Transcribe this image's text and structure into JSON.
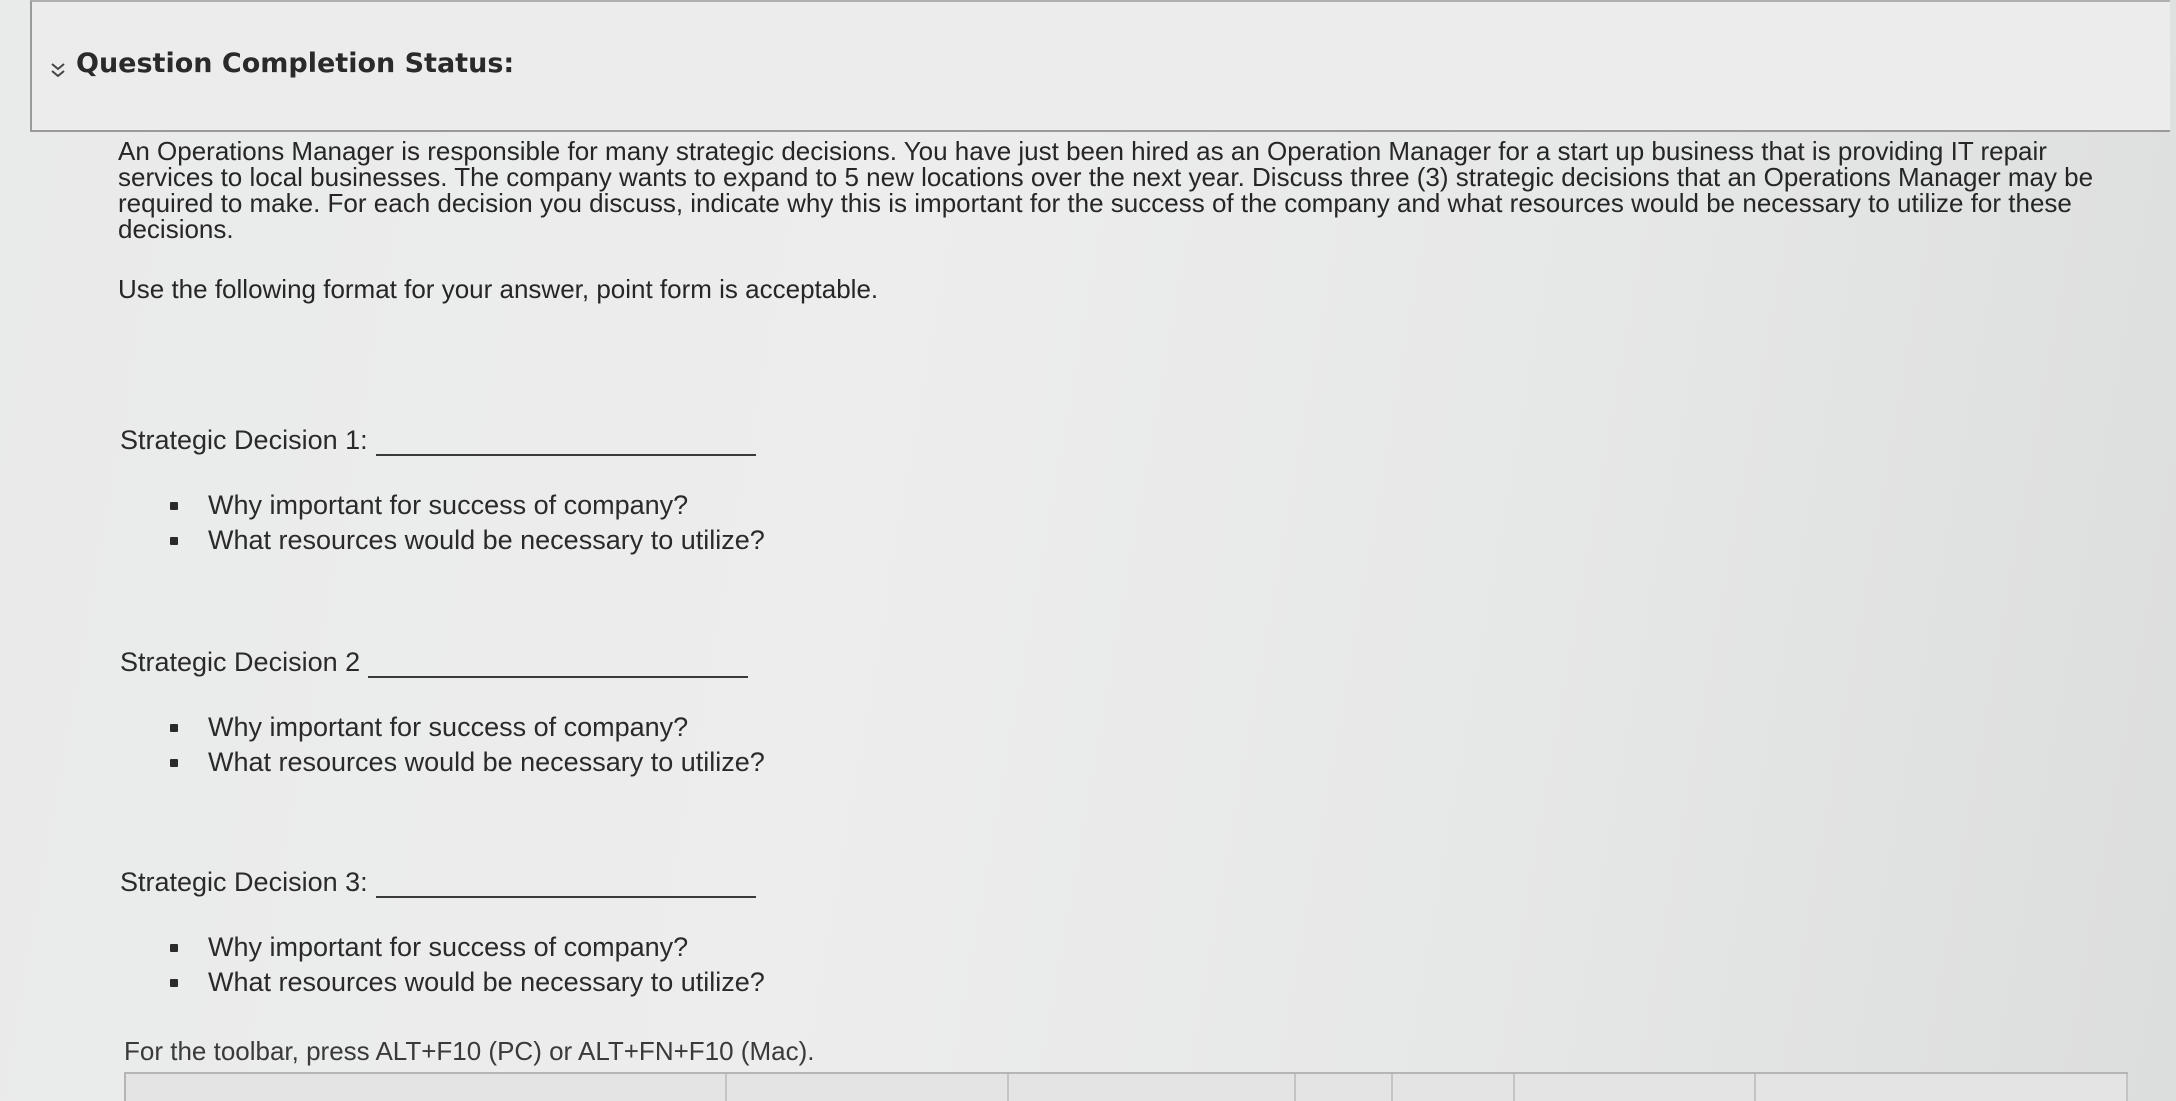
{
  "status": {
    "header": "Question Completion Status:"
  },
  "question": {
    "paragraph": "An Operations Manager is responsible for many strategic decisions. You have just been hired as an Operation Manager for a start up business that is providing IT repair services to local businesses. The company wants to expand to 5 new locations over the next year. Discuss three (3) strategic decisions that an Operations Manager may be required to make. For each decision you discuss, indicate why this is important for the success of the company and what resources would be necessary to utilize for these decisions.",
    "instruction": "Use the following format for your answer, point form is acceptable."
  },
  "decisions": [
    {
      "title": "Strategic Decision 1:",
      "bullets": [
        "Why important for success of company?",
        "What resources would be necessary to utilize?"
      ]
    },
    {
      "title": "Strategic Decision 2",
      "bullets": [
        "Why important for success of company?",
        "What resources would be necessary to utilize?"
      ]
    },
    {
      "title": "Strategic Decision 3:",
      "bullets": [
        "Why important for success of company?",
        "What resources would be necessary to utilize?"
      ]
    }
  ],
  "toolbar_hint": "For the toolbar, press ALT+F10 (PC) or ALT+FN+F10 (Mac)."
}
